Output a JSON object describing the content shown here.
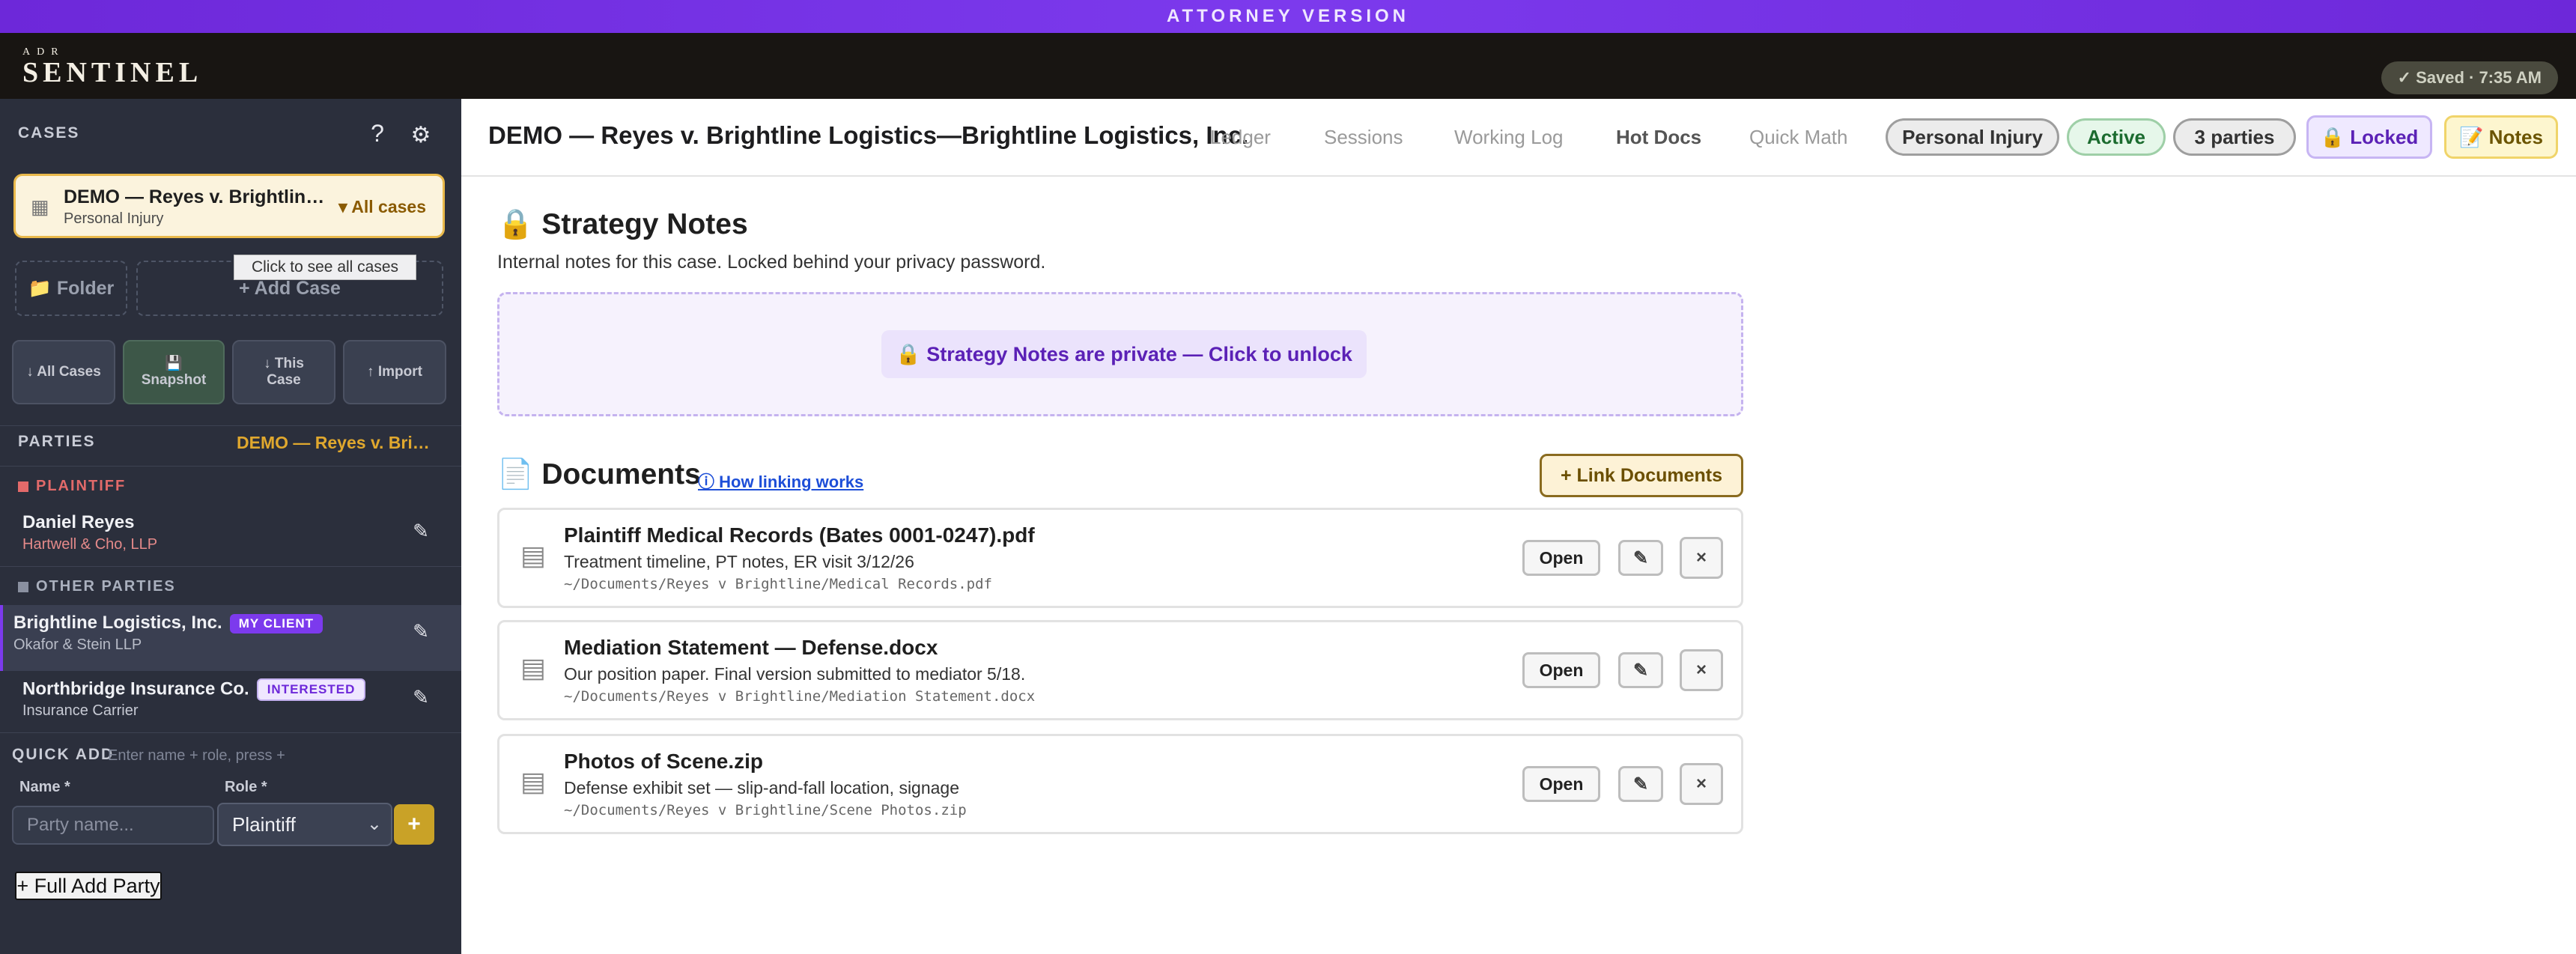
{
  "banner": "ATTORNEY VERSION",
  "brand": {
    "small": "ADR",
    "big": "SENTINEL"
  },
  "saved": "✓ Saved · 7:35 AM",
  "sidebar": {
    "cases_label": "CASES",
    "help_icon": "?",
    "settings_icon": "⚙",
    "current_case": {
      "title": "DEMO — Reyes v. Brightline Logistics—Brightline Logistics, Inc.",
      "type": "Personal Injury",
      "all_cases": "▾ All cases"
    },
    "tooltip": "Click to see all cases",
    "folder_btn": "📁 Folder",
    "add_case_btn": "+ Add Case",
    "actions": [
      {
        "label": "↓ All Cases"
      },
      {
        "icon": "💾",
        "label": "Snapshot"
      },
      {
        "label": "↓ This Case"
      },
      {
        "label": "↑ Import"
      }
    ],
    "parties_label": "PARTIES",
    "parties_case": "DEMO — Reyes v. Brightline Logistics",
    "plaintiff_label": "PLAINTIFF",
    "plaintiff": {
      "name": "Daniel Reyes",
      "firm": "Hartwell & Cho, LLP"
    },
    "other_label": "OTHER PARTIES",
    "others": [
      {
        "name": "Brightline Logistics, Inc.",
        "badge": "MY CLIENT",
        "firm": "Okafor & Stein LLP"
      },
      {
        "name": "Northbridge Insurance Co.",
        "badge": "INTERESTED",
        "firm": "Insurance Carrier"
      }
    ],
    "quick_add": {
      "label": "QUICK ADD",
      "hint": "Enter name + role, press +",
      "name_label": "Name *",
      "role_label": "Role *",
      "name_placeholder": "Party name...",
      "role_value": "Plaintiff",
      "plus": "+"
    },
    "full_add": "+ Full Add Party"
  },
  "header": {
    "case_name": "DEMO — Reyes v. Brightline Logistics—Brightline Logistics, Inc.",
    "tabs": [
      "Ledger",
      "Sessions",
      "Working Log",
      "Hot Docs",
      "Quick Math"
    ],
    "pills": {
      "type": "Personal Injury",
      "status": "Active",
      "parties": "3 parties",
      "locked": "🔒 Locked",
      "notes": "📝 Notes"
    }
  },
  "strategy": {
    "title": "🔒 Strategy Notes",
    "desc": "Internal notes for this case. Locked behind your privacy password.",
    "unlock": "🔒 Strategy Notes are private — Click to unlock"
  },
  "documents": {
    "title": "📄 Documents",
    "how_link": "ⓘ How linking works",
    "link_btn": "+ Link Documents",
    "open_label": "Open",
    "edit_icon": "✎",
    "remove_icon": "×",
    "items": [
      {
        "name": "Plaintiff Medical Records (Bates 0001-0247).pdf",
        "desc": "Treatment timeline, PT notes, ER visit 3/12/26",
        "path": "~/Documents/Reyes v Brightline/Medical Records.pdf"
      },
      {
        "name": "Mediation Statement — Defense.docx",
        "desc": "Our position paper. Final version submitted to mediator 5/18.",
        "path": "~/Documents/Reyes v Brightline/Mediation Statement.docx"
      },
      {
        "name": "Photos of Scene.zip",
        "desc": "Defense exhibit set — slip-and-fall location, signage",
        "path": "~/Documents/Reyes v Brightline/Scene Photos.zip"
      }
    ]
  }
}
